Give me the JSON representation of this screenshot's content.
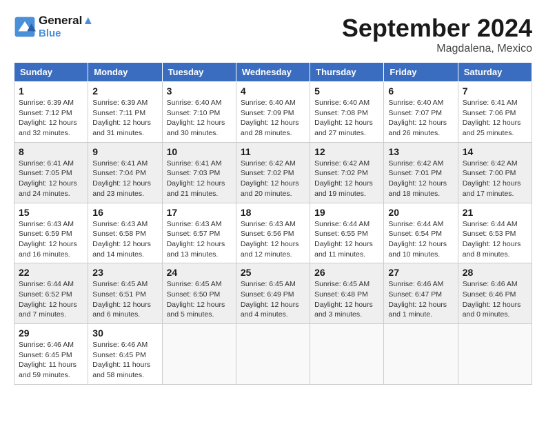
{
  "logo": {
    "line1": "General",
    "line2": "Blue"
  },
  "title": "September 2024",
  "location": "Magdalena, Mexico",
  "days_header": [
    "Sunday",
    "Monday",
    "Tuesday",
    "Wednesday",
    "Thursday",
    "Friday",
    "Saturday"
  ],
  "weeks": [
    [
      {
        "day": "1",
        "info": "Sunrise: 6:39 AM\nSunset: 7:12 PM\nDaylight: 12 hours\nand 32 minutes."
      },
      {
        "day": "2",
        "info": "Sunrise: 6:39 AM\nSunset: 7:11 PM\nDaylight: 12 hours\nand 31 minutes."
      },
      {
        "day": "3",
        "info": "Sunrise: 6:40 AM\nSunset: 7:10 PM\nDaylight: 12 hours\nand 30 minutes."
      },
      {
        "day": "4",
        "info": "Sunrise: 6:40 AM\nSunset: 7:09 PM\nDaylight: 12 hours\nand 28 minutes."
      },
      {
        "day": "5",
        "info": "Sunrise: 6:40 AM\nSunset: 7:08 PM\nDaylight: 12 hours\nand 27 minutes."
      },
      {
        "day": "6",
        "info": "Sunrise: 6:40 AM\nSunset: 7:07 PM\nDaylight: 12 hours\nand 26 minutes."
      },
      {
        "day": "7",
        "info": "Sunrise: 6:41 AM\nSunset: 7:06 PM\nDaylight: 12 hours\nand 25 minutes."
      }
    ],
    [
      {
        "day": "8",
        "info": "Sunrise: 6:41 AM\nSunset: 7:05 PM\nDaylight: 12 hours\nand 24 minutes."
      },
      {
        "day": "9",
        "info": "Sunrise: 6:41 AM\nSunset: 7:04 PM\nDaylight: 12 hours\nand 23 minutes."
      },
      {
        "day": "10",
        "info": "Sunrise: 6:41 AM\nSunset: 7:03 PM\nDaylight: 12 hours\nand 21 minutes."
      },
      {
        "day": "11",
        "info": "Sunrise: 6:42 AM\nSunset: 7:02 PM\nDaylight: 12 hours\nand 20 minutes."
      },
      {
        "day": "12",
        "info": "Sunrise: 6:42 AM\nSunset: 7:02 PM\nDaylight: 12 hours\nand 19 minutes."
      },
      {
        "day": "13",
        "info": "Sunrise: 6:42 AM\nSunset: 7:01 PM\nDaylight: 12 hours\nand 18 minutes."
      },
      {
        "day": "14",
        "info": "Sunrise: 6:42 AM\nSunset: 7:00 PM\nDaylight: 12 hours\nand 17 minutes."
      }
    ],
    [
      {
        "day": "15",
        "info": "Sunrise: 6:43 AM\nSunset: 6:59 PM\nDaylight: 12 hours\nand 16 minutes."
      },
      {
        "day": "16",
        "info": "Sunrise: 6:43 AM\nSunset: 6:58 PM\nDaylight: 12 hours\nand 14 minutes."
      },
      {
        "day": "17",
        "info": "Sunrise: 6:43 AM\nSunset: 6:57 PM\nDaylight: 12 hours\nand 13 minutes."
      },
      {
        "day": "18",
        "info": "Sunrise: 6:43 AM\nSunset: 6:56 PM\nDaylight: 12 hours\nand 12 minutes."
      },
      {
        "day": "19",
        "info": "Sunrise: 6:44 AM\nSunset: 6:55 PM\nDaylight: 12 hours\nand 11 minutes."
      },
      {
        "day": "20",
        "info": "Sunrise: 6:44 AM\nSunset: 6:54 PM\nDaylight: 12 hours\nand 10 minutes."
      },
      {
        "day": "21",
        "info": "Sunrise: 6:44 AM\nSunset: 6:53 PM\nDaylight: 12 hours\nand 8 minutes."
      }
    ],
    [
      {
        "day": "22",
        "info": "Sunrise: 6:44 AM\nSunset: 6:52 PM\nDaylight: 12 hours\nand 7 minutes."
      },
      {
        "day": "23",
        "info": "Sunrise: 6:45 AM\nSunset: 6:51 PM\nDaylight: 12 hours\nand 6 minutes."
      },
      {
        "day": "24",
        "info": "Sunrise: 6:45 AM\nSunset: 6:50 PM\nDaylight: 12 hours\nand 5 minutes."
      },
      {
        "day": "25",
        "info": "Sunrise: 6:45 AM\nSunset: 6:49 PM\nDaylight: 12 hours\nand 4 minutes."
      },
      {
        "day": "26",
        "info": "Sunrise: 6:45 AM\nSunset: 6:48 PM\nDaylight: 12 hours\nand 3 minutes."
      },
      {
        "day": "27",
        "info": "Sunrise: 6:46 AM\nSunset: 6:47 PM\nDaylight: 12 hours\nand 1 minute."
      },
      {
        "day": "28",
        "info": "Sunrise: 6:46 AM\nSunset: 6:46 PM\nDaylight: 12 hours\nand 0 minutes."
      }
    ],
    [
      {
        "day": "29",
        "info": "Sunrise: 6:46 AM\nSunset: 6:45 PM\nDaylight: 11 hours\nand 59 minutes."
      },
      {
        "day": "30",
        "info": "Sunrise: 6:46 AM\nSunset: 6:45 PM\nDaylight: 11 hours\nand 58 minutes."
      },
      {
        "day": "",
        "info": ""
      },
      {
        "day": "",
        "info": ""
      },
      {
        "day": "",
        "info": ""
      },
      {
        "day": "",
        "info": ""
      },
      {
        "day": "",
        "info": ""
      }
    ]
  ]
}
